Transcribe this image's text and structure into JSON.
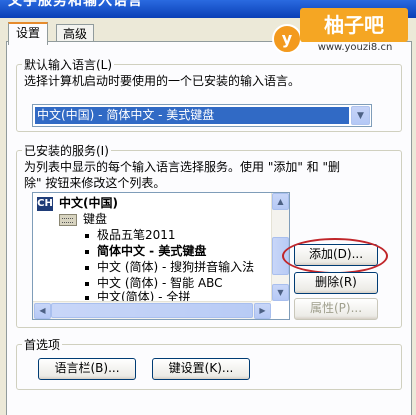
{
  "window": {
    "title": "文字服务和输入语言"
  },
  "watermark": {
    "logo_letter": "y",
    "brand": "柚子吧",
    "url": "www.youzi8.cn"
  },
  "tabs": [
    {
      "label": "设置",
      "active": true
    },
    {
      "label": "高级",
      "active": false
    }
  ],
  "default_language": {
    "group_title": "默认输入语言(L)",
    "description": "选择计算机启动时要使用的一个已安装的输入语言。",
    "selected_value": "中文(中国) - 简体中文 - 美式键盘"
  },
  "installed_services": {
    "group_title": "已安装的服务(I)",
    "description_line1": "为列表中显示的每个输入语言选择服务。使用 \"添加\" 和 \"删",
    "description_line2": "除\" 按钮来修改这个列表。",
    "tree": {
      "language_badge": "CH",
      "language": "中文(中国)",
      "category": "键盘",
      "items": [
        {
          "label": "极品五笔2011",
          "bold": false
        },
        {
          "label": "简体中文 - 美式键盘",
          "bold": true
        },
        {
          "label": "中文 (简体) - 搜狗拼音输入法",
          "bold": false
        },
        {
          "label": "中文 (简体) - 智能 ABC",
          "bold": false
        },
        {
          "label": "中文(简体) - 全拼",
          "bold": false
        }
      ]
    },
    "buttons": {
      "add": "添加(D)...",
      "remove": "删除(R)",
      "properties": "属性(P)..."
    }
  },
  "preferences": {
    "group_title": "首选项",
    "language_bar_button": "语言栏(B)...",
    "key_settings_button": "键设置(K)..."
  },
  "colors": {
    "selection": "#316ac5",
    "highlight_ring": "#c0262a",
    "watermark_orange": "#f5a623"
  },
  "icons": {
    "dropdown": "chevron-down-icon",
    "scroll_up": "arrow-up-icon",
    "scroll_down": "arrow-down-icon",
    "scroll_left": "arrow-left-icon",
    "scroll_right": "arrow-right-icon"
  }
}
